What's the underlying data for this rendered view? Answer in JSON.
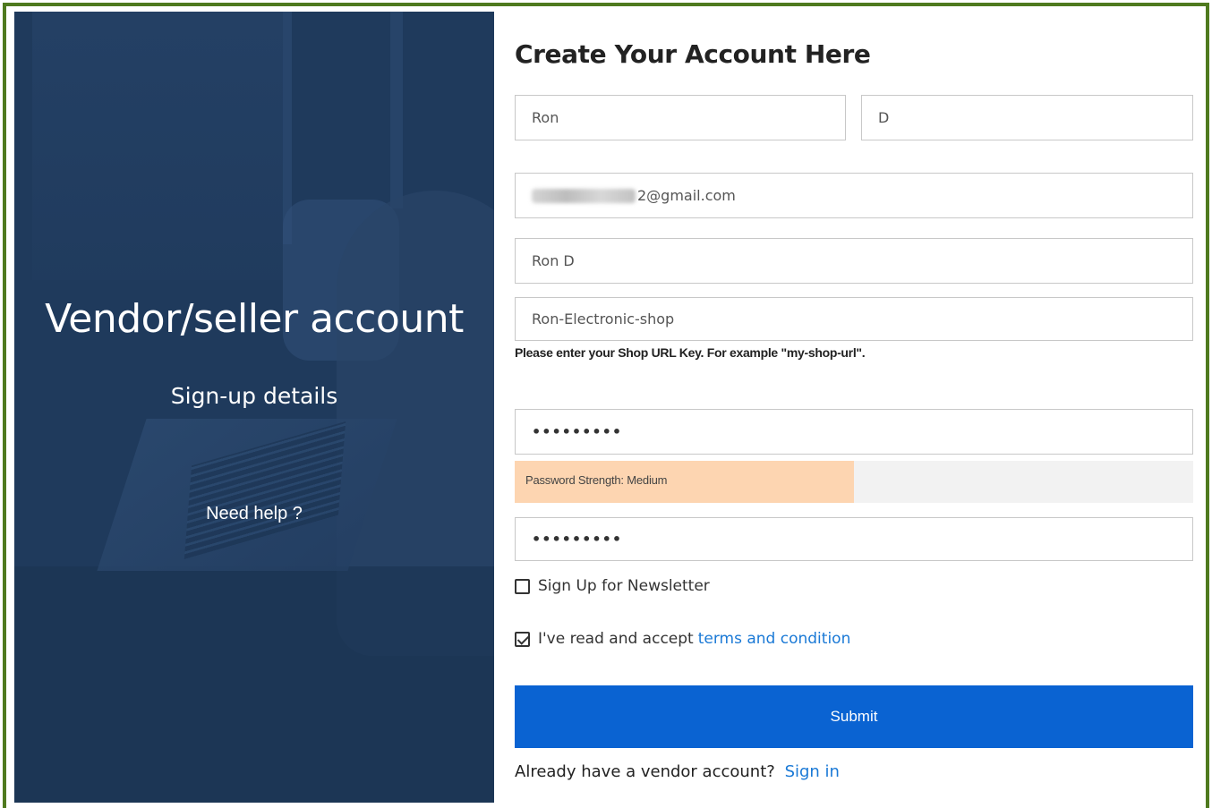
{
  "left": {
    "title": "Vendor/seller account",
    "subtitle": "Sign-up details",
    "help": "Need help ?"
  },
  "form": {
    "title": "Create Your Account Here",
    "first_name": "Ron",
    "last_name": "D",
    "email_visible_suffix": "2@gmail.com",
    "shop_name": "Ron D",
    "shop_url": "Ron-Electronic-shop",
    "shop_url_hint": "Please enter your Shop URL Key. For example \"my-shop-url\".",
    "password_mask": "•••••••••",
    "password_strength_label": "Password Strength: Medium",
    "password_strength_fraction": 0.5,
    "confirm_password_mask": "•••••••••",
    "newsletter_label": "Sign Up for Newsletter",
    "newsletter_checked": false,
    "terms_prefix": "I've read and accept",
    "terms_link": "terms and condition",
    "terms_checked": true,
    "submit_label": "Submit",
    "signin_prefix": "Already have a vendor account?",
    "signin_link": "Sign in"
  },
  "colors": {
    "frame_border": "#4f7a1f",
    "left_panel": "#1f3a5c",
    "submit_bg": "#0a63d2",
    "link": "#1a79d6",
    "strength_medium": "#fdd5b1"
  }
}
